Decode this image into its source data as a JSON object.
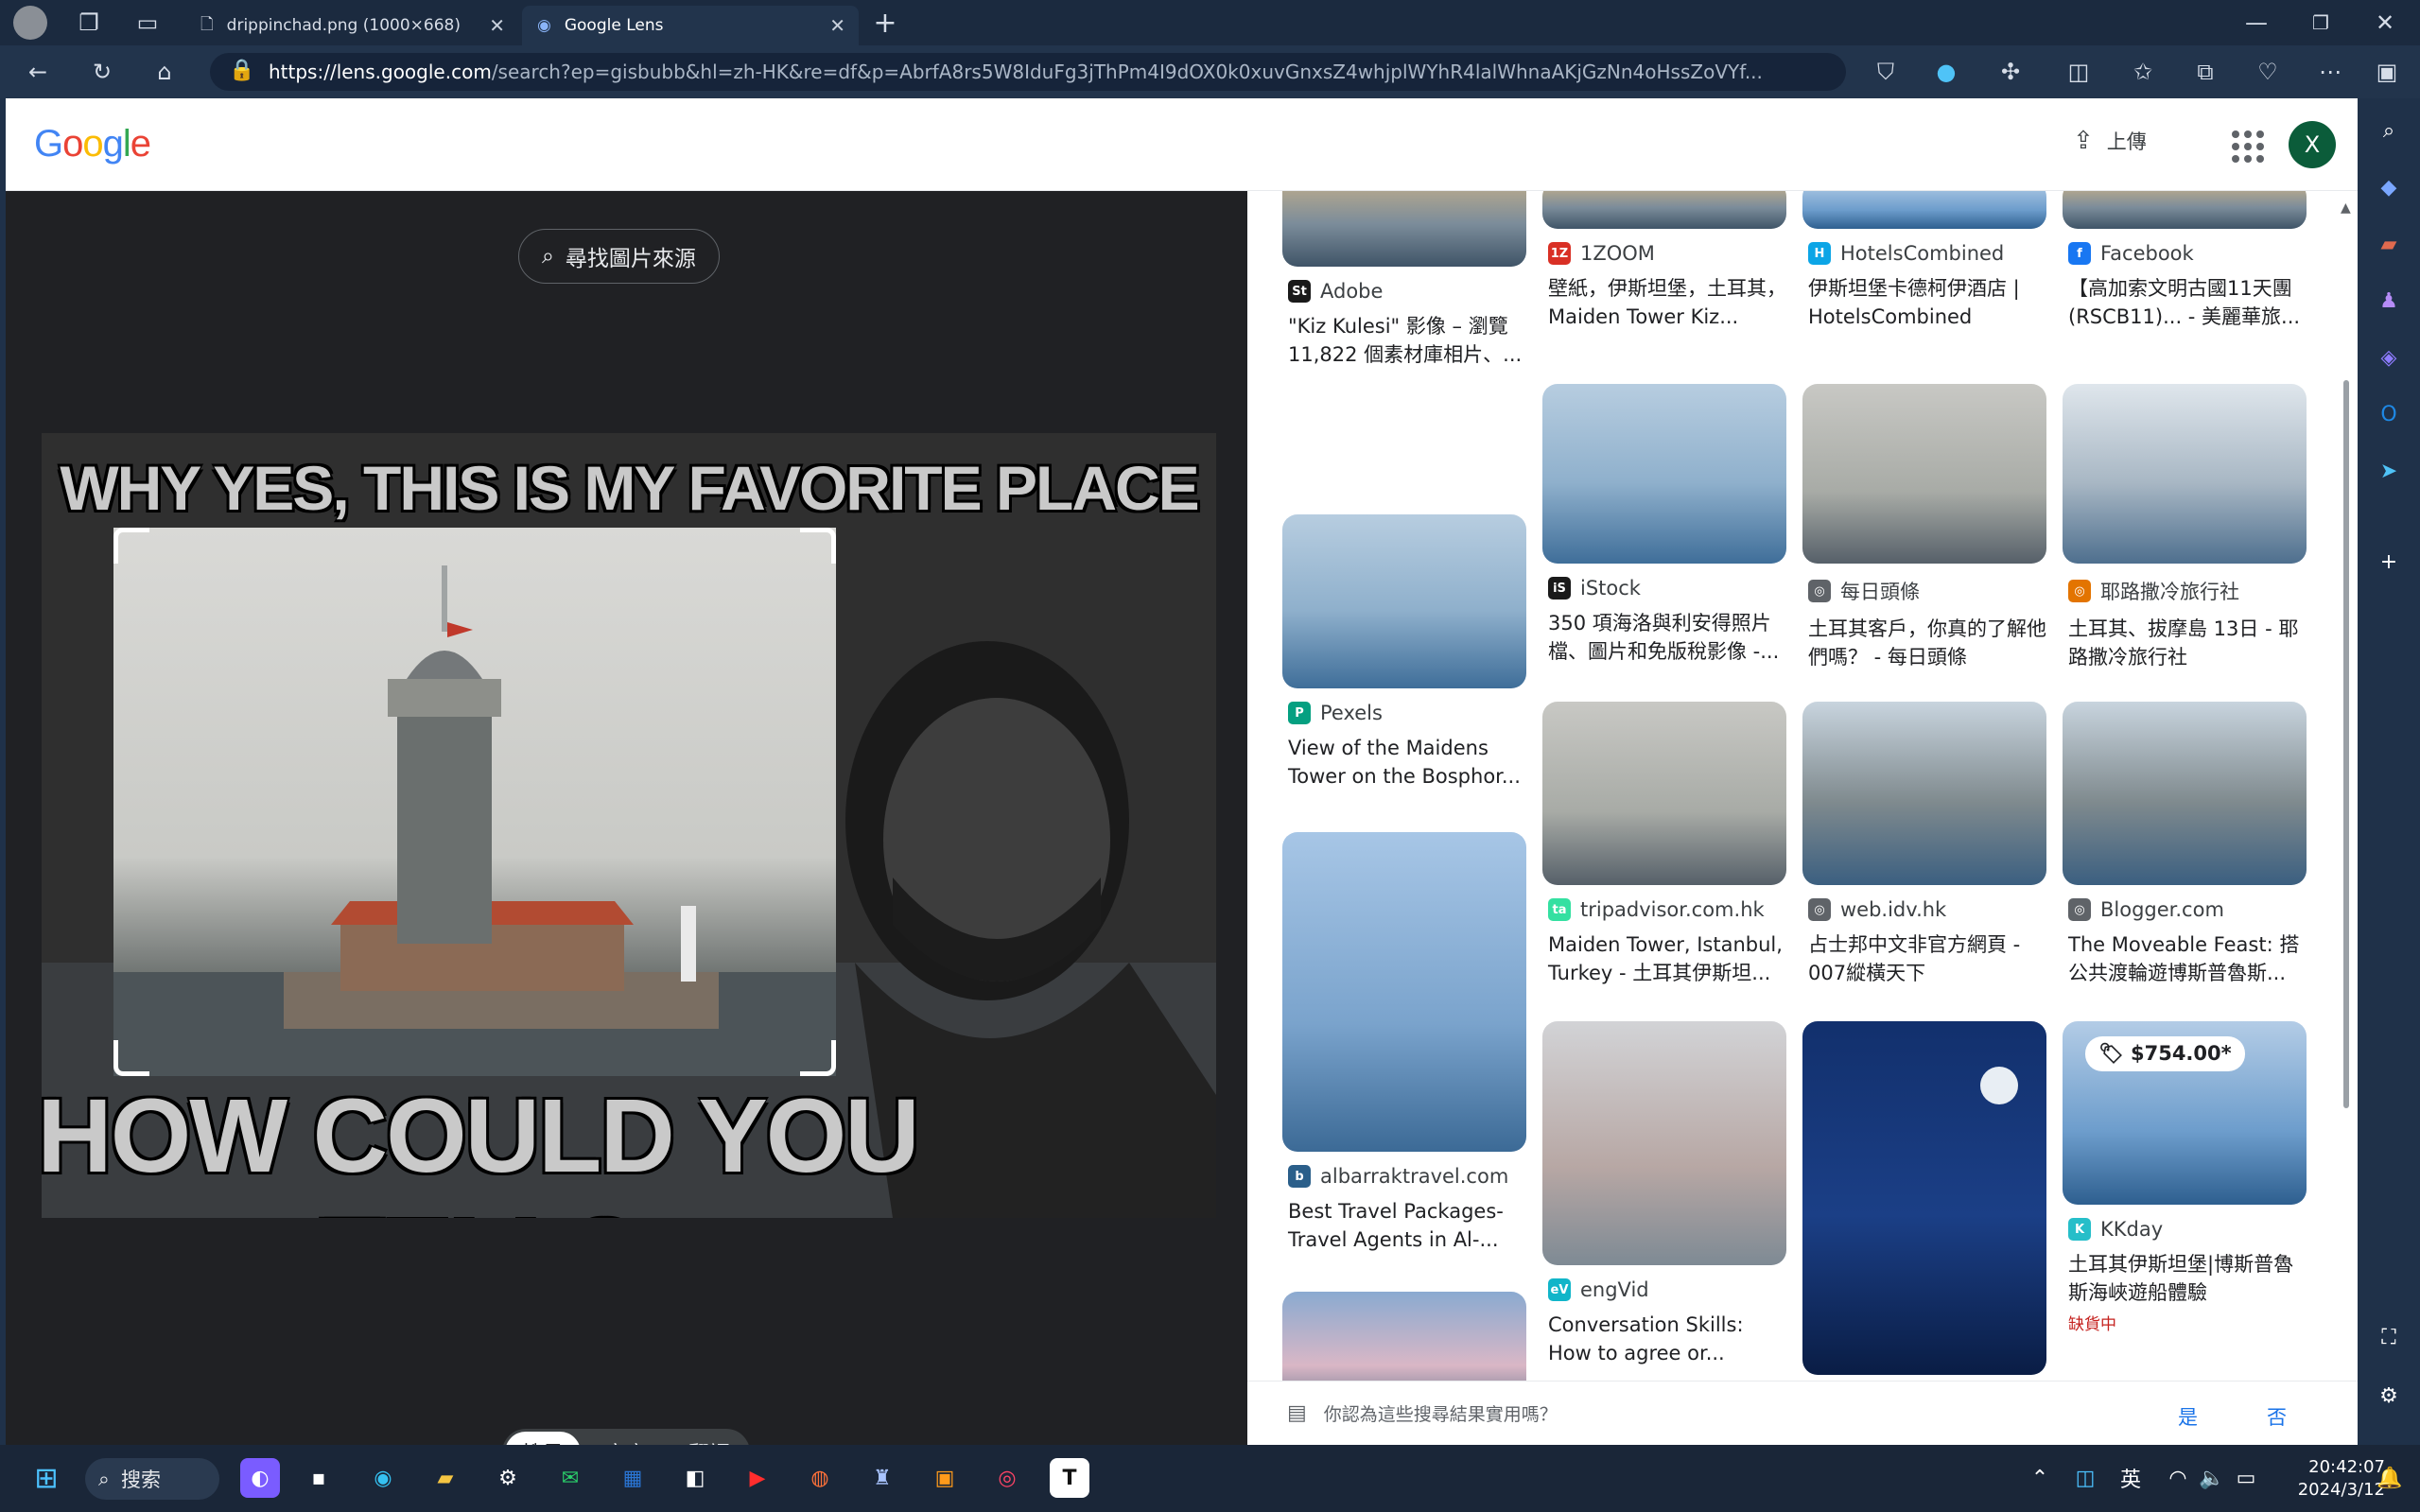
{
  "browser": {
    "tabs": [
      {
        "label": "drippinchad.png (1000×668)",
        "active": false
      },
      {
        "label": "Google Lens",
        "active": true
      }
    ],
    "url_host": "https://lens.google.com",
    "url_rest": "/search?ep=gisbubb&hl=zh-HK&re=df&p=AbrfA8rs5W8IduFg3jThPm4I9dOX0k0xuvGnxsZ4whjplWYhR4lalWhnaAKjGzNn4oHssZoVYf..."
  },
  "header": {
    "logo": "Google",
    "upload_label": "上傳",
    "avatar_letter": "X"
  },
  "viewer": {
    "find_source_label": "尋找圖片來源",
    "meme_top_text": "WHY YES, THIS IS MY FAVORITE PLACE TO RELAX",
    "meme_bottom_text": "HOW COULD YOU TELL?",
    "modes": [
      "搜尋",
      "文字",
      "翻譯"
    ]
  },
  "results": {
    "columns": [
      [
        {
          "source": "Adobe",
          "title": "\"Kiz Kulesi\" 影像 – 瀏覽 11,822 個素材庫相片、...",
          "favicon": "St",
          "favicon_color": "#1a1a1a",
          "theme": "sunset"
        },
        {
          "source": "Pexels",
          "title": "View of the Maidens Tower on the Bosphor...",
          "favicon": "P",
          "favicon_color": "#05a081",
          "theme": "blue"
        },
        {
          "source": "albarraktravel.com",
          "title": "Best Travel Packages- Travel Agents in Al-...",
          "favicon": "b",
          "favicon_color": "#2b5f8a",
          "theme": "sky"
        },
        {
          "source": "",
          "title": "",
          "favicon": "",
          "favicon_color": "#ffffff",
          "theme": "dusk"
        }
      ],
      [
        {
          "source": "1ZOOM",
          "title": "壁紙，伊斯坦堡，土耳其，Maiden Tower Kiz...",
          "favicon": "1Z",
          "favicon_color": "#d93025",
          "theme": "sunset"
        },
        {
          "source": "iStock",
          "title": "350 項海洛與利安得照片檔、圖片和免版稅影像 -...",
          "favicon": "iS",
          "favicon_color": "#1a1a1a",
          "theme": "blue"
        },
        {
          "source": "tripadvisor.com.hk",
          "title": "Maiden Tower, Istanbul, Turkey - 土耳其伊斯坦...",
          "favicon": "ta",
          "favicon_color": "#34e0a1",
          "theme": "grey"
        },
        {
          "source": "engVid",
          "title": "Conversation Skills: How to agree or...",
          "favicon": "eV",
          "favicon_color": "#11b5c9",
          "theme": "blurry"
        }
      ],
      [
        {
          "source": "HotelsCombined",
          "title": "伊斯坦堡卡德柯伊酒店 | HotelsCombined",
          "favicon": "H",
          "favicon_color": "#0ca5e6",
          "theme": "sea"
        },
        {
          "source": "每日頭條",
          "title": "土耳其客戶，你真的了解他們嗎？ - 每日頭條",
          "favicon": "◎",
          "favicon_color": "#5f6368",
          "theme": "grey"
        },
        {
          "source": "web.idv.hk",
          "title": "占士邦中文非官方網頁 - 007縱橫天下",
          "favicon": "◎",
          "favicon_color": "#5f6368",
          "theme": "city"
        },
        {
          "source": "",
          "title": "",
          "favicon": "",
          "favicon_color": "#ffffff",
          "theme": "night"
        }
      ],
      [
        {
          "source": "Facebook",
          "title": "【高加索文明古國11天團 (RSCB11)... - 美麗華旅...",
          "favicon": "f",
          "favicon_color": "#1877f2",
          "theme": "sunset"
        },
        {
          "source": "耶路撒冷旅行社",
          "title": "土耳其、拔摩島 13日 - 耶路撒冷旅行社",
          "favicon": "◎",
          "favicon_color": "#e37400",
          "theme": "cloud"
        },
        {
          "source": "Blogger.com",
          "title": "The Moveable Feast: 搭公共渡輪遊博斯普魯斯...",
          "favicon": "◎",
          "favicon_color": "#5f6368",
          "theme": "city"
        },
        {
          "source": "KKday",
          "title": "土耳其伊斯坦堡|博斯普魯斯海峽遊船體驗",
          "favicon": "K",
          "favicon_color": "#26bec9",
          "theme": "sea",
          "price": "$754.00*",
          "stock": "缺貨中"
        }
      ]
    ],
    "feedback_question": "你認為這些搜尋結果實用嗎？",
    "feedback_yes": "是",
    "feedback_no": "否"
  },
  "taskbar": {
    "search_label": "搜索",
    "ime": "英",
    "time": "20:42:07",
    "date": "2024/3/12"
  }
}
